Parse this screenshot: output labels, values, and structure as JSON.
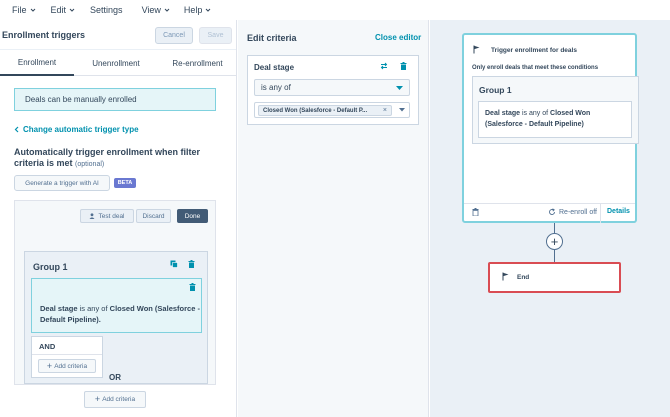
{
  "menu": [
    "File",
    "Edit",
    "Settings",
    "View",
    "Help"
  ],
  "left": {
    "title": "Enrollment triggers",
    "cancel": "Cancel",
    "save": "Save",
    "tabs": [
      "Enrollment",
      "Unenrollment",
      "Re-enrollment"
    ],
    "info": "Deals can be manually enrolled",
    "change_link": "Change automatic trigger type",
    "auto_title": "Automatically trigger enrollment when filter criteria is met",
    "optional": "(optional)",
    "generate": "Generate a trigger with AI",
    "beta": "BETA",
    "test_deal": "Test deal",
    "discard": "Discard",
    "done": "Done",
    "group_title": "Group 1",
    "criteria": {
      "prop": "Deal stage",
      "op": "is any of",
      "val": "Closed Won (Salesforce - Default Pipeline)."
    },
    "and": "AND",
    "add_criteria": "Add criteria",
    "or": "OR"
  },
  "mid": {
    "title": "Edit criteria",
    "close": "Close editor",
    "property": "Deal stage",
    "operator": "is any of",
    "tag": "Closed Won (Salesforce - Default P..."
  },
  "canvas": {
    "trigger_title": "Trigger enrollment for deals",
    "only_enroll": "Only enroll deals that meet these conditions",
    "group_title": "Group 1",
    "criteria": {
      "prop": "Deal stage",
      "op": "is any of",
      "val": "Closed Won (Salesforce - Default Pipeline)"
    },
    "reenroll": "Re-enroll off",
    "details": "Details",
    "plus": "+",
    "end": "End"
  },
  "colors": {
    "link": "#0091ae",
    "teal_border": "#7fd1de",
    "end_border": "#d94c53",
    "dark_button": "#425b76"
  }
}
